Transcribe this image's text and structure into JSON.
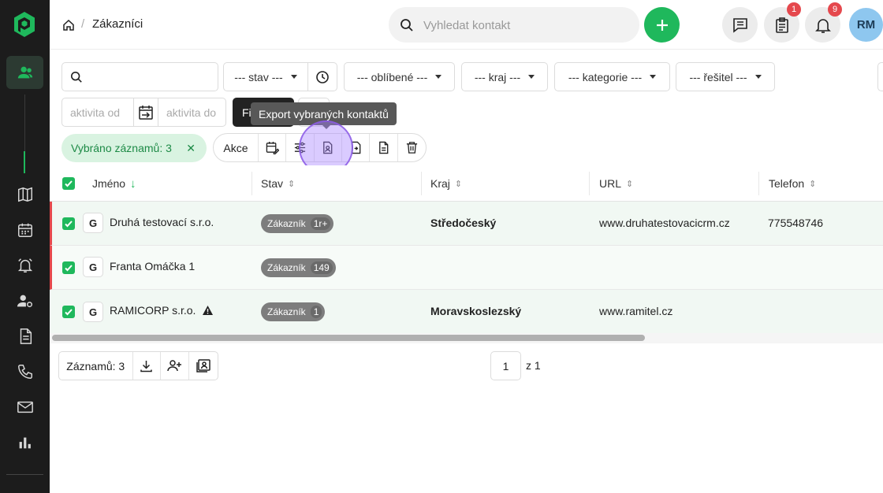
{
  "colors": {
    "accent": "#1fb85c",
    "sidebar": "#1c1c1c",
    "danger": "#e5484d",
    "highlight": "#a882ff"
  },
  "sidebar": {
    "items": [
      {
        "icon": "contacts-icon",
        "active": true
      },
      {
        "icon": "map-icon"
      },
      {
        "icon": "calendar-icon"
      },
      {
        "icon": "alarm-bell-icon"
      },
      {
        "icon": "user-settings-icon"
      },
      {
        "icon": "document-icon"
      },
      {
        "icon": "phone-icon"
      },
      {
        "icon": "mail-icon"
      },
      {
        "icon": "bar-chart-icon"
      }
    ]
  },
  "header": {
    "breadcrumb_separator": "/",
    "breadcrumb_title": "Zákazníci",
    "search_placeholder": "Vyhledat kontakt",
    "tasks_badge": "1",
    "notifications_badge": "9",
    "avatar_initials": "RM"
  },
  "filters": {
    "stav": "--- stav ---",
    "oblibene": "--- oblíbené ---",
    "kraj": "--- kraj ---",
    "kategorie": "--- kategorie ---",
    "resitel": "--- řešitel ---",
    "aktivita_od_placeholder": "aktivita od",
    "aktivita_do_placeholder": "aktivita do",
    "filter_button_label": "Fi"
  },
  "tooltip": {
    "text": "Export vybraných kontaktů"
  },
  "selection": {
    "chip_label": "Vybráno záznamů: 3",
    "close_symbol": "✕",
    "actions_label": "Akce"
  },
  "table": {
    "columns": {
      "jmeno": "Jméno",
      "stav": "Stav",
      "kraj": "Kraj",
      "url": "URL",
      "telefon": "Telefon"
    },
    "rows": [
      {
        "logo": "G",
        "name": "Druhá testovací s.r.o.",
        "status": "Zákazník",
        "status_count": "1r+",
        "kraj": "Středočeský",
        "url": "www.druhatestovacicrm.cz",
        "phone": "775548746"
      },
      {
        "logo": "G",
        "name": "Franta Omáčka 1",
        "status": "Zákazník",
        "status_count": "149",
        "kraj": "",
        "url": "",
        "phone": ""
      },
      {
        "logo": "G",
        "name": "RAMICORP s.r.o.",
        "status": "Zákazník",
        "status_count": "1",
        "kraj": "Moravskoslezský",
        "url": "www.ramitel.cz",
        "phone": ""
      }
    ]
  },
  "footer": {
    "records_label": "Záznamů: 3",
    "page": "1",
    "page_of": "z 1"
  }
}
